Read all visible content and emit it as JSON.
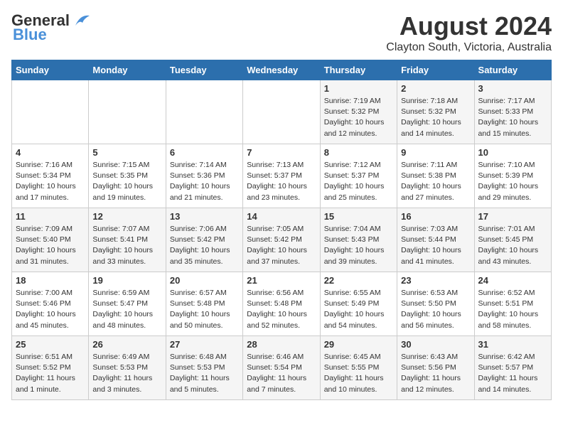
{
  "header": {
    "logo_general": "General",
    "logo_blue": "Blue",
    "month_year": "August 2024",
    "location": "Clayton South, Victoria, Australia"
  },
  "days_of_week": [
    "Sunday",
    "Monday",
    "Tuesday",
    "Wednesday",
    "Thursday",
    "Friday",
    "Saturday"
  ],
  "weeks": [
    [
      {
        "day": "",
        "info": ""
      },
      {
        "day": "",
        "info": ""
      },
      {
        "day": "",
        "info": ""
      },
      {
        "day": "",
        "info": ""
      },
      {
        "day": "1",
        "info": "Sunrise: 7:19 AM\nSunset: 5:32 PM\nDaylight: 10 hours\nand 12 minutes."
      },
      {
        "day": "2",
        "info": "Sunrise: 7:18 AM\nSunset: 5:32 PM\nDaylight: 10 hours\nand 14 minutes."
      },
      {
        "day": "3",
        "info": "Sunrise: 7:17 AM\nSunset: 5:33 PM\nDaylight: 10 hours\nand 15 minutes."
      }
    ],
    [
      {
        "day": "4",
        "info": "Sunrise: 7:16 AM\nSunset: 5:34 PM\nDaylight: 10 hours\nand 17 minutes."
      },
      {
        "day": "5",
        "info": "Sunrise: 7:15 AM\nSunset: 5:35 PM\nDaylight: 10 hours\nand 19 minutes."
      },
      {
        "day": "6",
        "info": "Sunrise: 7:14 AM\nSunset: 5:36 PM\nDaylight: 10 hours\nand 21 minutes."
      },
      {
        "day": "7",
        "info": "Sunrise: 7:13 AM\nSunset: 5:37 PM\nDaylight: 10 hours\nand 23 minutes."
      },
      {
        "day": "8",
        "info": "Sunrise: 7:12 AM\nSunset: 5:37 PM\nDaylight: 10 hours\nand 25 minutes."
      },
      {
        "day": "9",
        "info": "Sunrise: 7:11 AM\nSunset: 5:38 PM\nDaylight: 10 hours\nand 27 minutes."
      },
      {
        "day": "10",
        "info": "Sunrise: 7:10 AM\nSunset: 5:39 PM\nDaylight: 10 hours\nand 29 minutes."
      }
    ],
    [
      {
        "day": "11",
        "info": "Sunrise: 7:09 AM\nSunset: 5:40 PM\nDaylight: 10 hours\nand 31 minutes."
      },
      {
        "day": "12",
        "info": "Sunrise: 7:07 AM\nSunset: 5:41 PM\nDaylight: 10 hours\nand 33 minutes."
      },
      {
        "day": "13",
        "info": "Sunrise: 7:06 AM\nSunset: 5:42 PM\nDaylight: 10 hours\nand 35 minutes."
      },
      {
        "day": "14",
        "info": "Sunrise: 7:05 AM\nSunset: 5:42 PM\nDaylight: 10 hours\nand 37 minutes."
      },
      {
        "day": "15",
        "info": "Sunrise: 7:04 AM\nSunset: 5:43 PM\nDaylight: 10 hours\nand 39 minutes."
      },
      {
        "day": "16",
        "info": "Sunrise: 7:03 AM\nSunset: 5:44 PM\nDaylight: 10 hours\nand 41 minutes."
      },
      {
        "day": "17",
        "info": "Sunrise: 7:01 AM\nSunset: 5:45 PM\nDaylight: 10 hours\nand 43 minutes."
      }
    ],
    [
      {
        "day": "18",
        "info": "Sunrise: 7:00 AM\nSunset: 5:46 PM\nDaylight: 10 hours\nand 45 minutes."
      },
      {
        "day": "19",
        "info": "Sunrise: 6:59 AM\nSunset: 5:47 PM\nDaylight: 10 hours\nand 48 minutes."
      },
      {
        "day": "20",
        "info": "Sunrise: 6:57 AM\nSunset: 5:48 PM\nDaylight: 10 hours\nand 50 minutes."
      },
      {
        "day": "21",
        "info": "Sunrise: 6:56 AM\nSunset: 5:48 PM\nDaylight: 10 hours\nand 52 minutes."
      },
      {
        "day": "22",
        "info": "Sunrise: 6:55 AM\nSunset: 5:49 PM\nDaylight: 10 hours\nand 54 minutes."
      },
      {
        "day": "23",
        "info": "Sunrise: 6:53 AM\nSunset: 5:50 PM\nDaylight: 10 hours\nand 56 minutes."
      },
      {
        "day": "24",
        "info": "Sunrise: 6:52 AM\nSunset: 5:51 PM\nDaylight: 10 hours\nand 58 minutes."
      }
    ],
    [
      {
        "day": "25",
        "info": "Sunrise: 6:51 AM\nSunset: 5:52 PM\nDaylight: 11 hours\nand 1 minute."
      },
      {
        "day": "26",
        "info": "Sunrise: 6:49 AM\nSunset: 5:53 PM\nDaylight: 11 hours\nand 3 minutes."
      },
      {
        "day": "27",
        "info": "Sunrise: 6:48 AM\nSunset: 5:53 PM\nDaylight: 11 hours\nand 5 minutes."
      },
      {
        "day": "28",
        "info": "Sunrise: 6:46 AM\nSunset: 5:54 PM\nDaylight: 11 hours\nand 7 minutes."
      },
      {
        "day": "29",
        "info": "Sunrise: 6:45 AM\nSunset: 5:55 PM\nDaylight: 11 hours\nand 10 minutes."
      },
      {
        "day": "30",
        "info": "Sunrise: 6:43 AM\nSunset: 5:56 PM\nDaylight: 11 hours\nand 12 minutes."
      },
      {
        "day": "31",
        "info": "Sunrise: 6:42 AM\nSunset: 5:57 PM\nDaylight: 11 hours\nand 14 minutes."
      }
    ]
  ]
}
